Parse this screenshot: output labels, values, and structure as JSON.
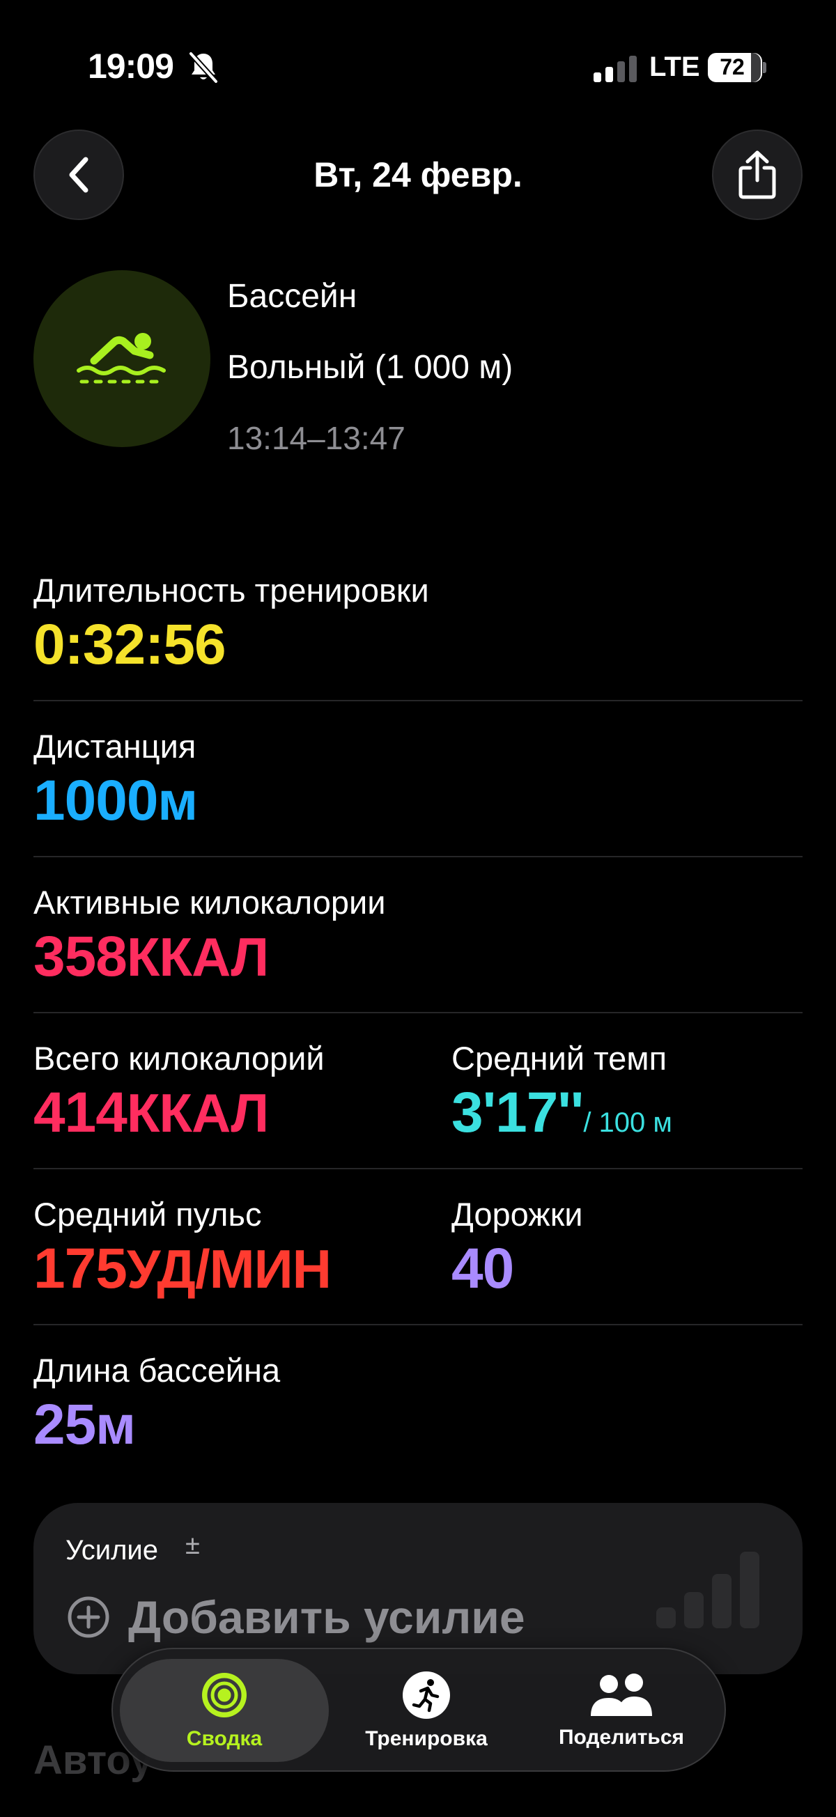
{
  "status_bar": {
    "time": "19:09",
    "network": "LTE",
    "battery": "72"
  },
  "nav": {
    "title": "Вт, 24 февр.",
    "back_icon": "chevron-left-icon",
    "share_icon": "share-icon"
  },
  "workout": {
    "icon": "swimming-icon",
    "title": "Бассейн",
    "subtitle": "Вольный (1 000 м)",
    "time_range": "13:14–13:47"
  },
  "metrics": {
    "duration": {
      "label": "Длительность тренировки",
      "value": "0:32:56",
      "color": "#f5e22b"
    },
    "distance": {
      "label": "Дистанция",
      "value": "1000",
      "unit": "м",
      "color": "#1aaeff"
    },
    "active_kcal": {
      "label": "Активные килокалории",
      "value": "358",
      "unit": "ККАЛ",
      "color": "#ff2d5f"
    },
    "total_kcal": {
      "label": "Всего килокалорий",
      "value": "414",
      "unit": "ККАЛ",
      "color": "#ff2d5f"
    },
    "avg_pace": {
      "label": "Средний темп",
      "value": "3'17''",
      "unit": "/ 100 м",
      "color": "#3be0e0"
    },
    "avg_hr": {
      "label": "Средний пульс",
      "value": "175",
      "unit": "УД/МИН",
      "color": "#ff3b30"
    },
    "lanes": {
      "label": "Дорожки",
      "value": "40",
      "color": "#a98bff"
    },
    "pool_length": {
      "label": "Длина бассейна",
      "value": "25",
      "unit": "м",
      "color": "#a98bff"
    }
  },
  "effort": {
    "label": "Усилие",
    "pm": "±",
    "add_label": "Добавить усилие"
  },
  "behind_text": "Автоу",
  "tabs": [
    {
      "label": "Сводка",
      "icon": "activity-rings-icon",
      "active": true
    },
    {
      "label": "Тренировка",
      "icon": "running-figure-icon",
      "active": false
    },
    {
      "label": "Поделиться",
      "icon": "people-icon",
      "active": false
    }
  ]
}
